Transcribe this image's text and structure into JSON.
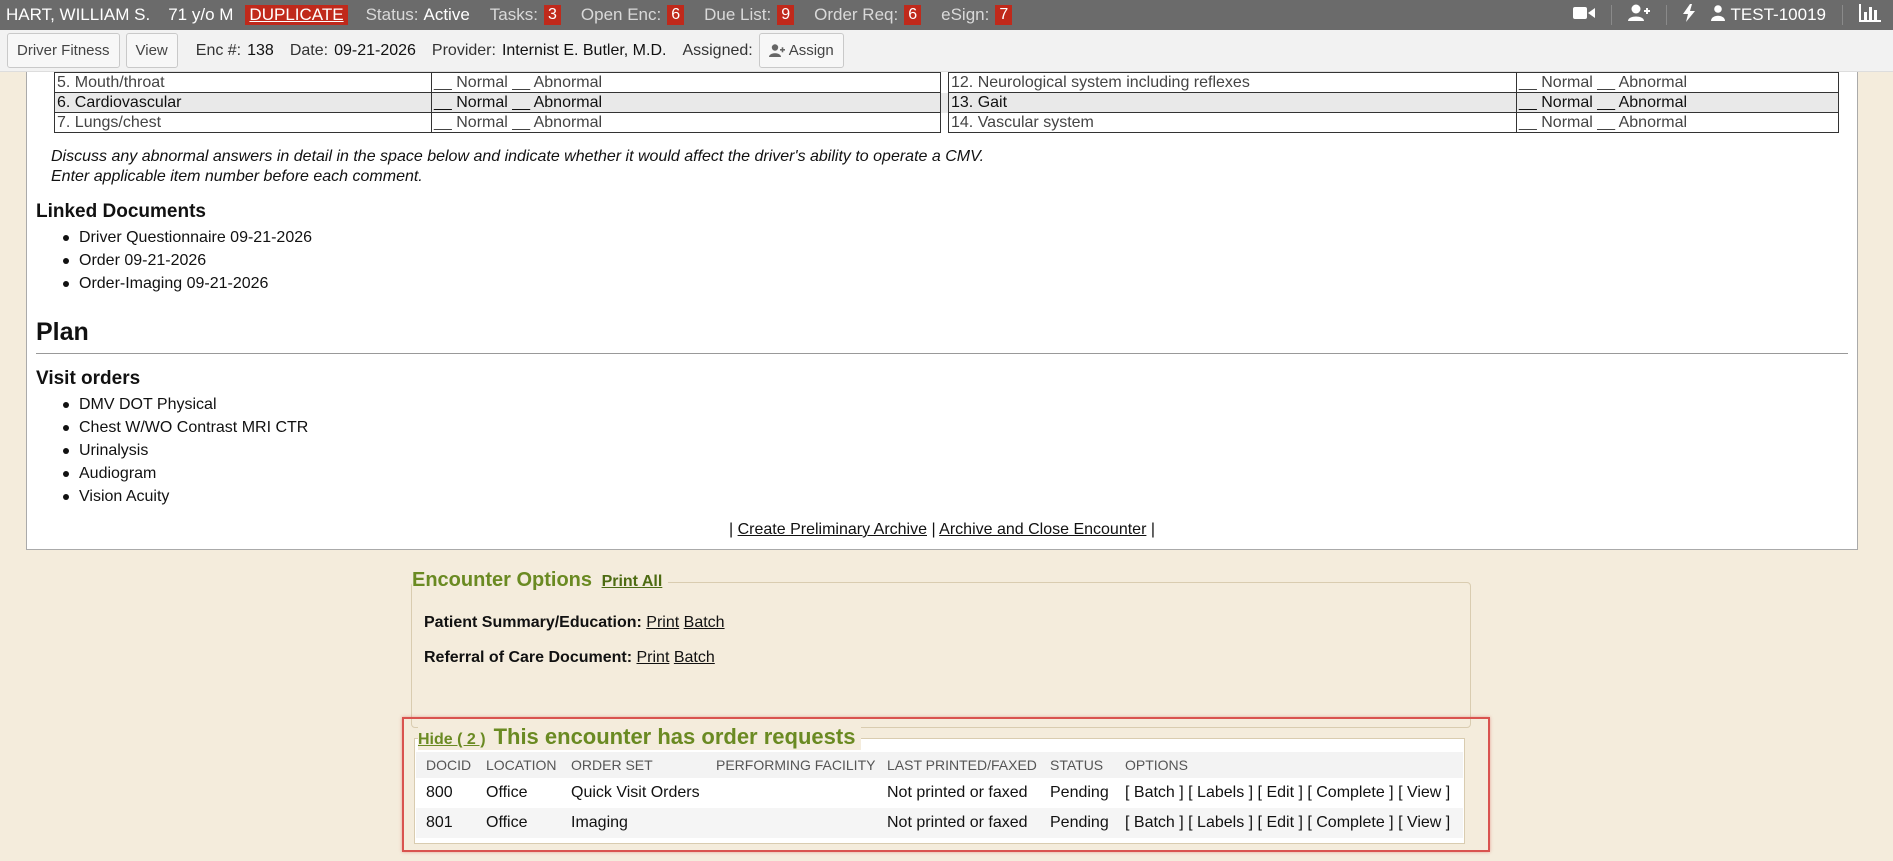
{
  "patient_bar": {
    "name": "HART, WILLIAM S.",
    "age_sex": "71 y/o M",
    "duplicate": "DUPLICATE",
    "status_label": "Status:",
    "status_value": "Active",
    "tasks_label": "Tasks:",
    "tasks_count": "3",
    "open_enc_label": "Open Enc:",
    "open_enc_count": "6",
    "due_list_label": "Due List:",
    "due_list_count": "9",
    "order_req_label": "Order Req:",
    "order_req_count": "6",
    "esign_label": "eSign:",
    "esign_count": "7",
    "user_id": "TEST-10019"
  },
  "toolbar": {
    "driver_fitness": "Driver Fitness",
    "view": "View",
    "enc_label": "Enc #:",
    "enc_value": "138",
    "date_label": "Date:",
    "date_value": "09-21-2026",
    "provider_label": "Provider:",
    "provider_value": "Internist E. Butler, M.D.",
    "assigned_label": "Assigned:",
    "assign_button": "Assign"
  },
  "exam_table": {
    "rows": [
      {
        "left_item": "5. Mouth/throat",
        "left_result": "__ Normal __ Abnormal",
        "right_item": "12. Neurological system including reflexes",
        "right_result": "__ Normal __ Abnormal"
      },
      {
        "left_item": "6. Cardiovascular",
        "left_result": "__ Normal __ Abnormal",
        "right_item": "13. Gait",
        "right_result": "__ Normal __ Abnormal"
      },
      {
        "left_item": "7. Lungs/chest",
        "left_result": "__ Normal __ Abnormal",
        "right_item": "14. Vascular system",
        "right_result": "__ Normal __ Abnormal"
      }
    ]
  },
  "discuss": {
    "line1": "Discuss any abnormal answers in detail in the space below and indicate whether it would affect the driver's ability to operate a CMV.",
    "line2": "Enter applicable item number before each comment."
  },
  "linked_documents": {
    "heading": "Linked Documents",
    "items": [
      "Driver Questionnaire 09-21-2026",
      "Order 09-21-2026",
      "Order-Imaging 09-21-2026"
    ]
  },
  "plan": {
    "heading": "Plan",
    "visit_orders_heading": "Visit orders",
    "visit_orders": [
      "DMV DOT Physical",
      "Chest W/WO Contrast MRI CTR",
      "Urinalysis",
      "Audiogram",
      "Vision Acuity"
    ]
  },
  "archive_links": {
    "create_preliminary": "Create Preliminary Archive",
    "archive_close": "Archive and Close Encounter",
    "separator": "|"
  },
  "encounter_options": {
    "title": "Encounter Options",
    "print_all": "Print All",
    "patient_summary_label": "Patient Summary/Education:",
    "referral_label": "Referral of Care Document:",
    "print": "Print",
    "batch": "Batch"
  },
  "order_requests": {
    "hide_link": "Hide ( 2 )",
    "title": "This encounter has order requests",
    "columns": [
      "DOCID",
      "LOCATION",
      "ORDER SET",
      "PERFORMING FACILITY",
      "LAST PRINTED/FAXED",
      "STATUS",
      "OPTIONS"
    ],
    "rows": [
      {
        "docid": "800",
        "location": "Office",
        "order_set": "Quick Visit Orders",
        "facility": "",
        "last_printed": "Not printed or faxed",
        "status": "Pending"
      },
      {
        "docid": "801",
        "location": "Office",
        "order_set": "Imaging",
        "facility": "",
        "last_printed": "Not printed or faxed",
        "status": "Pending"
      }
    ],
    "options": {
      "batch": "[ Batch ]",
      "labels": "[ Labels ]",
      "edit": "[ Edit ]",
      "complete": "[ Complete ]",
      "view": "[ View ]"
    }
  },
  "colors": {
    "topbar_bg": "#6b6b6b",
    "badge_red": "#c0291b",
    "page_bg": "#f4ecdc",
    "section_green": "#6a8a22",
    "highlight_box": "#d9534f"
  }
}
